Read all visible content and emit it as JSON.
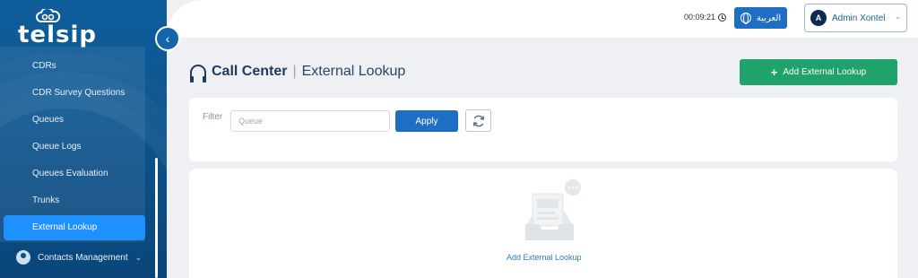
{
  "brand": {
    "logo_text": "telsip"
  },
  "sidebar": {
    "items": [
      {
        "label": "CDRs"
      },
      {
        "label": "CDR Survey Questions"
      },
      {
        "label": "Queues"
      },
      {
        "label": "Queue Logs"
      },
      {
        "label": "Queues Evaluation"
      },
      {
        "label": "Trunks"
      },
      {
        "label": "External Lookup",
        "active": true
      }
    ],
    "group": {
      "label": "Contacts Management"
    }
  },
  "header": {
    "timer": "00:09:21",
    "language_label": "العربية",
    "user": {
      "initial": "A",
      "name": "Admin Xontel"
    }
  },
  "page": {
    "title_section": "Call Center",
    "title_page": "External Lookup",
    "add_button_label": "Add External Lookup"
  },
  "filter": {
    "label": "Filter",
    "queue_placeholder": "Queue",
    "apply_label": "Apply"
  },
  "empty_state": {
    "link_label": "Add External Lookup"
  },
  "colors": {
    "sidebar": "#0b4f87",
    "primary": "#1e6fc4",
    "success": "#1fa26b",
    "active_item": "#1e90ff"
  }
}
